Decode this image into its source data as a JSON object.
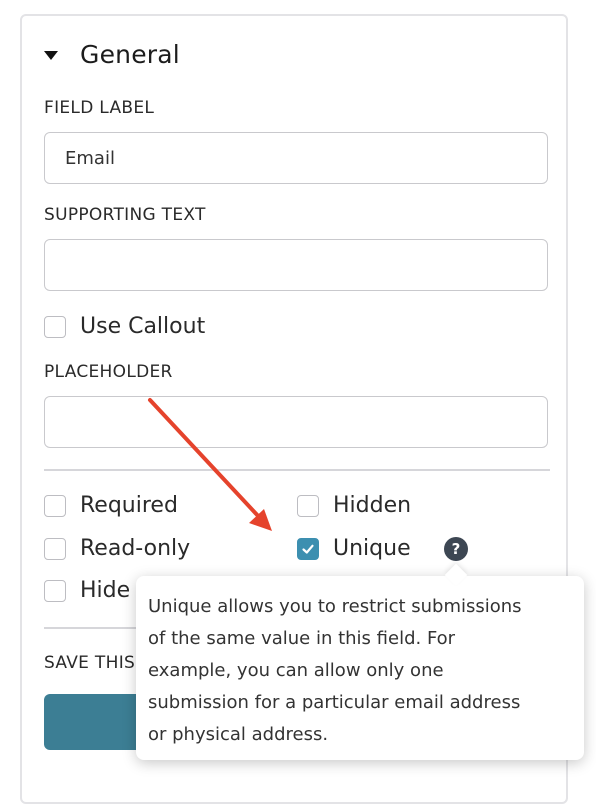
{
  "section": {
    "title": "General",
    "toggle_icon": "triangle-down-icon"
  },
  "field_label": {
    "label": "FIELD LABEL",
    "value": "Email"
  },
  "supporting_text": {
    "label": "SUPPORTING TEXT",
    "value": ""
  },
  "use_callout": {
    "label": "Use Callout",
    "checked": false
  },
  "placeholder": {
    "label": "PLACEHOLDER",
    "value": ""
  },
  "options": {
    "required": {
      "label": "Required",
      "checked": false
    },
    "hidden": {
      "label": "Hidden",
      "checked": false
    },
    "read_only": {
      "label": "Read-only",
      "checked": false
    },
    "unique": {
      "label": "Unique",
      "checked": true
    },
    "hide": {
      "label": "Hide",
      "checked": false
    }
  },
  "help_icon": {
    "name": "question-circle-icon",
    "glyph": "?"
  },
  "save_section": {
    "label": "SAVE THIS"
  },
  "tooltip": {
    "lines": [
      "Unique allows you to restrict submissions",
      "of the same value in this field. For",
      "example, you can allow only one",
      "submission for a particular email address",
      "or physical address."
    ]
  },
  "colors": {
    "accent": "#3c8fb0",
    "button": "#3c7e94",
    "annotation_arrow": "#e5432c"
  }
}
